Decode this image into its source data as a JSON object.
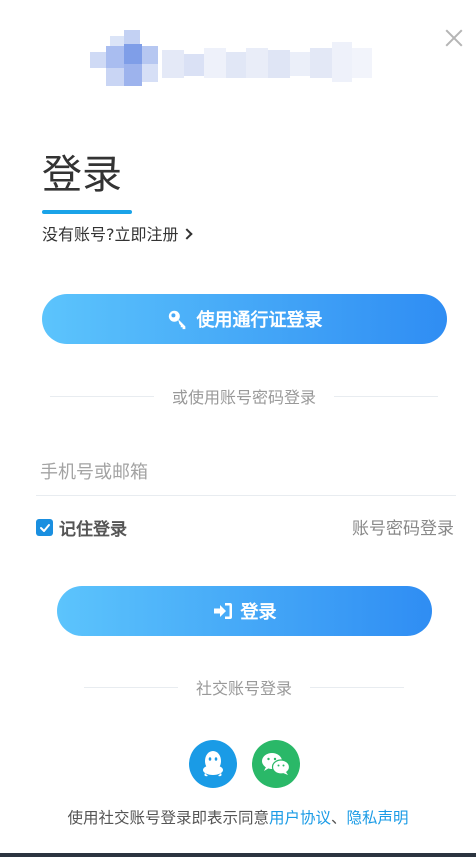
{
  "close": {
    "icon": "close-icon"
  },
  "logo": {
    "icon": "blurred-logo"
  },
  "header": {
    "title": "登录",
    "no_account": "没有账号?",
    "register_link": "立即注册"
  },
  "passport_button": {
    "label": "使用通行证登录",
    "icon": "key-icon"
  },
  "divider_password": {
    "label": "或使用账号密码登录"
  },
  "account_input": {
    "placeholder": "手机号或邮箱",
    "value": ""
  },
  "remember": {
    "label": "记住登录",
    "checked": true
  },
  "password_login_link": "账号密码登录",
  "login_button": {
    "label": "登录",
    "icon": "sign-in-icon"
  },
  "divider_social": {
    "label": "社交账号登录"
  },
  "social": [
    {
      "name": "qq",
      "icon": "qq-icon",
      "color": "#1a9be6"
    },
    {
      "name": "wechat",
      "icon": "wechat-icon",
      "color": "#2ab868"
    }
  ],
  "agreement": {
    "prefix": "使用社交账号登录即表示同意",
    "user_agreement": "用户协议",
    "separator": "、",
    "privacy": "隐私声明"
  },
  "colors": {
    "accent": "#1aa3e8",
    "button_gradient_start": "#5cc4fc",
    "button_gradient_end": "#2f8df3"
  }
}
